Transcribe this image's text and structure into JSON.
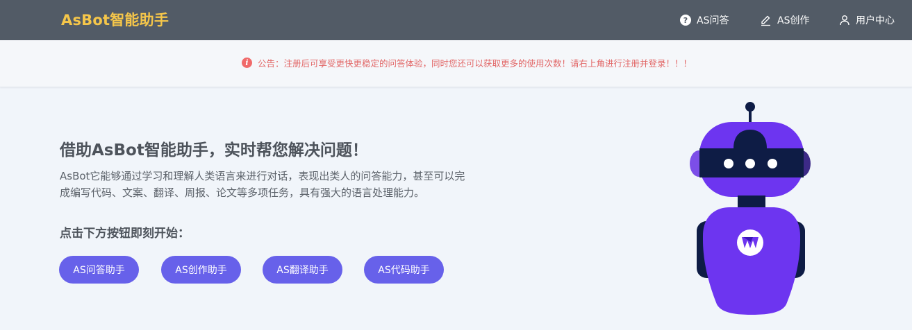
{
  "header": {
    "brand": "AsBot智能助手",
    "nav": [
      {
        "label": "AS问答",
        "icon": "question-circle-icon"
      },
      {
        "label": "AS创作",
        "icon": "pencil-icon"
      },
      {
        "label": "用户中心",
        "icon": "user-icon"
      }
    ]
  },
  "notice": {
    "icon": "info-icon",
    "text": "公告：注册后可享受更快更稳定的问答体验，同时您还可以获取更多的使用次数！请右上角进行注册并登录！！！"
  },
  "hero": {
    "title": "借助AsBot智能助手，实时帮您解决问题！",
    "description": "AsBot它能够通过学习和理解人类语言来进行对话，表现出类人的问答能力，甚至可以完成编写代码、文案、翻译、周报、论文等多项任务，具有强大的语言处理能力。",
    "cta_label": "点击下方按钮即刻开始：",
    "buttons": [
      {
        "label": "AS问答助手"
      },
      {
        "label": "AS创作助手"
      },
      {
        "label": "AS翻译助手"
      },
      {
        "label": "AS代码助手"
      }
    ]
  },
  "colors": {
    "header_bg": "#525b66",
    "brand": "#f5c64a",
    "notice_text": "#e26868",
    "button_bg": "#6761ea",
    "robot_purple": "#6d35f0",
    "robot_navy": "#0e1c45"
  }
}
